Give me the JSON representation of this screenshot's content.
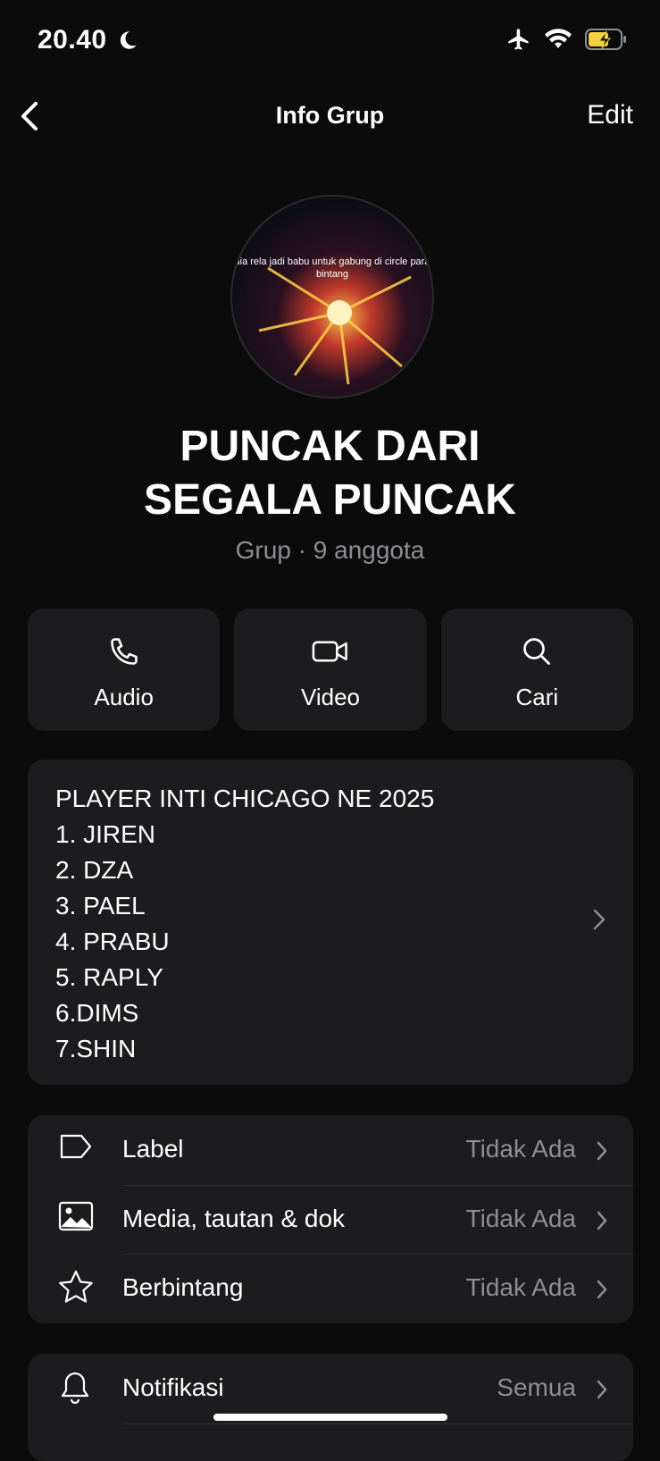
{
  "status_bar": {
    "time": "20.40"
  },
  "nav": {
    "title": "Info Grup",
    "edit_label": "Edit"
  },
  "group": {
    "avatar_caption": "dia rela jadi babu untuk gabung di circle para bintang",
    "name_line1": "PUNCAK DARI",
    "name_line2": "SEGALA PUNCAK",
    "subtitle": "Grup · 9 anggota"
  },
  "actions": [
    {
      "label": "Audio",
      "icon": "phone-icon"
    },
    {
      "label": "Video",
      "icon": "video-icon"
    },
    {
      "label": "Cari",
      "icon": "search-icon"
    }
  ],
  "description": {
    "lines": [
      "PLAYER INTI CHICAGO NE 2025",
      "1. JIREN",
      "2. DZA",
      "3. PAEL",
      "4. PRABU",
      "5. RAPLY",
      "6.DIMS",
      "7.SHIN"
    ]
  },
  "info_rows": [
    {
      "label": "Label",
      "value": "Tidak Ada",
      "icon": "label-icon"
    },
    {
      "label": "Media, tautan & dok",
      "value": "Tidak Ada",
      "icon": "media-icon"
    },
    {
      "label": "Berbintang",
      "value": "Tidak Ada",
      "icon": "star-icon"
    }
  ],
  "notif_row": {
    "label": "Notifikasi",
    "value": "Semua",
    "icon": "bell-icon"
  },
  "colors": {
    "background": "#0b0b0b",
    "card": "#1c1c1e",
    "secondary_text": "#8e8e93",
    "battery_fill": "#f4d03f"
  }
}
